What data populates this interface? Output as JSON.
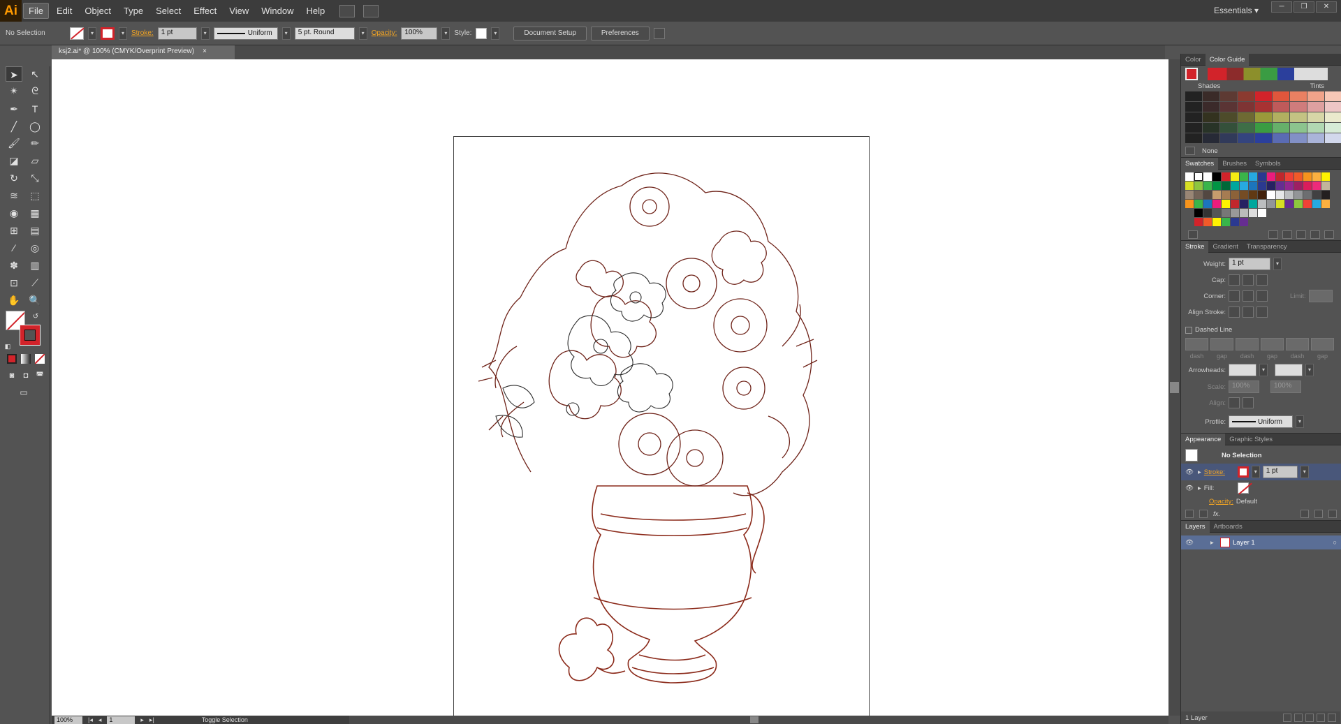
{
  "app": {
    "logo": "Ai",
    "menu": [
      "File",
      "Edit",
      "Object",
      "Type",
      "Select",
      "Effect",
      "View",
      "Window",
      "Help"
    ],
    "workspace": "Essentials ▾",
    "win_buttons": [
      "─",
      "❐",
      "✕"
    ]
  },
  "control": {
    "selection": "No Selection",
    "stroke_label": "Stroke:",
    "stroke_weight": "1 pt",
    "stroke_profile": "Uniform",
    "brush": "5 pt. Round",
    "opacity_label": "Opacity:",
    "opacity": "100%",
    "style_label": "Style:",
    "document_setup": "Document Setup",
    "preferences": "Preferences"
  },
  "document": {
    "tab": "ksj2.ai* @ 100% (CMYK/Overprint Preview)",
    "close": "×"
  },
  "status": {
    "zoom": "100%",
    "page": "1",
    "info": "Toggle Selection"
  },
  "color_panel": {
    "tabs": [
      "Color",
      "Color Guide"
    ],
    "shades": "Shades",
    "tints": "Tints",
    "none": "None"
  },
  "swatches_panel": {
    "tabs": [
      "Swatches",
      "Brushes",
      "Symbols"
    ]
  },
  "stroke_panel": {
    "tabs": [
      "Stroke",
      "Gradient",
      "Transparency"
    ],
    "weight_label": "Weight:",
    "weight": "1 pt",
    "cap_label": "Cap:",
    "corner_label": "Corner:",
    "limit_label": "Limit:",
    "align_label": "Align Stroke:",
    "dashed": "Dashed Line",
    "dash_labels": [
      "dash",
      "gap",
      "dash",
      "gap",
      "dash",
      "gap"
    ],
    "arrowheads": "Arrowheads:",
    "scale": "Scale:",
    "scale_a": "100%",
    "scale_b": "100%",
    "align": "Align:",
    "profile": "Profile:",
    "profile_value": "Uniform"
  },
  "appearance_panel": {
    "tabs": [
      "Appearance",
      "Graphic Styles"
    ],
    "title": "No Selection",
    "stroke": "Stroke:",
    "stroke_weight": "1 pt",
    "fill": "Fill:",
    "opacity": "Opacity:",
    "opacity_value": "Default"
  },
  "layers_panel": {
    "tabs": [
      "Layers",
      "Artboards"
    ],
    "layer": "Layer 1",
    "count": "1 Layer"
  },
  "colors": {
    "accent": "#d2232a",
    "stroke_art": "#8b2a1a"
  }
}
